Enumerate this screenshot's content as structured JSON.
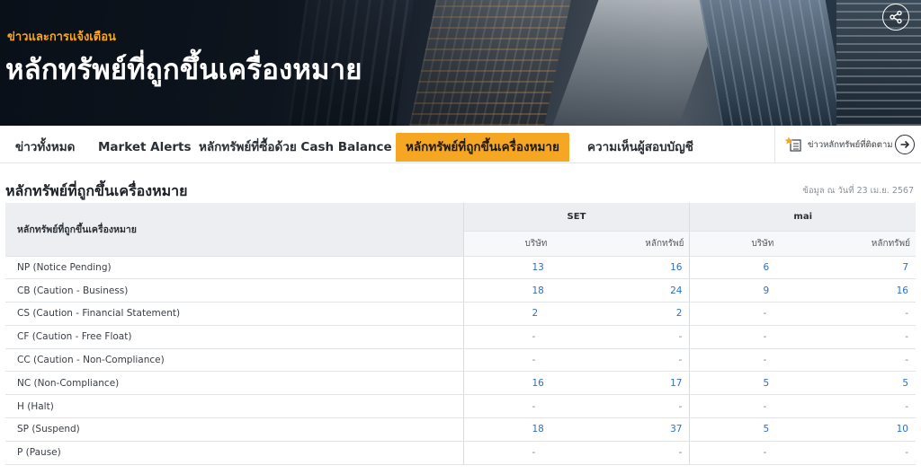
{
  "hero": {
    "kicker": "ข่าวและการแจ้งเตือน",
    "title": "หลักทรัพย์ที่ถูกขึ้นเครื่องหมาย"
  },
  "tabs": [
    {
      "label": "ข่าวทั้งหมด",
      "active": false
    },
    {
      "label": "Market Alerts",
      "active": false
    },
    {
      "label": "หลักทรัพย์ที่ซื้อด้วย Cash Balance",
      "active": false
    },
    {
      "label": "หลักทรัพย์ที่ถูกขึ้นเครื่องหมาย",
      "active": true
    },
    {
      "label": "ความเห็นผู้สอบบัญชี",
      "active": false
    }
  ],
  "follow_link": {
    "label": "ข่าวหลักทรัพย์ที่ติดตาม"
  },
  "section": {
    "title": "หลักทรัพย์ที่ถูกขึ้นเครื่องหมาย",
    "as_of": "ข้อมูล ณ วันที่ 23 เม.ย. 2567"
  },
  "table": {
    "row_header": "หลักทรัพย์ที่ถูกขึ้นเครื่องหมาย",
    "groups": [
      "SET",
      "mai"
    ],
    "sub_headers": [
      "บริษัท",
      "หลักทรัพย์",
      "บริษัท",
      "หลักทรัพย์"
    ],
    "rows": [
      {
        "name": "NP (Notice Pending)",
        "values": [
          "13",
          "16",
          "6",
          "7"
        ]
      },
      {
        "name": "CB (Caution - Business)",
        "values": [
          "18",
          "24",
          "9",
          "16"
        ]
      },
      {
        "name": "CS (Caution - Financial Statement)",
        "values": [
          "2",
          "2",
          "-",
          "-"
        ]
      },
      {
        "name": "CF (Caution - Free Float)",
        "values": [
          "-",
          "-",
          "-",
          "-"
        ]
      },
      {
        "name": "CC (Caution - Non-Compliance)",
        "values": [
          "-",
          "-",
          "-",
          "-"
        ]
      },
      {
        "name": "NC (Non-Compliance)",
        "values": [
          "16",
          "17",
          "5",
          "5"
        ]
      },
      {
        "name": "H (Halt)",
        "values": [
          "-",
          "-",
          "-",
          "-"
        ]
      },
      {
        "name": "SP (Suspend)",
        "values": [
          "18",
          "37",
          "5",
          "10"
        ]
      },
      {
        "name": "P (Pause)",
        "values": [
          "-",
          "-",
          "-",
          "-"
        ]
      }
    ]
  },
  "colors": {
    "accent": "#f5a623",
    "link_blue": "#2f6fc9",
    "header_bg": "#eceef1"
  },
  "icons": {
    "share": "share-icon",
    "follow": "star-list-icon",
    "arrow": "arrow-right-circle-icon"
  }
}
